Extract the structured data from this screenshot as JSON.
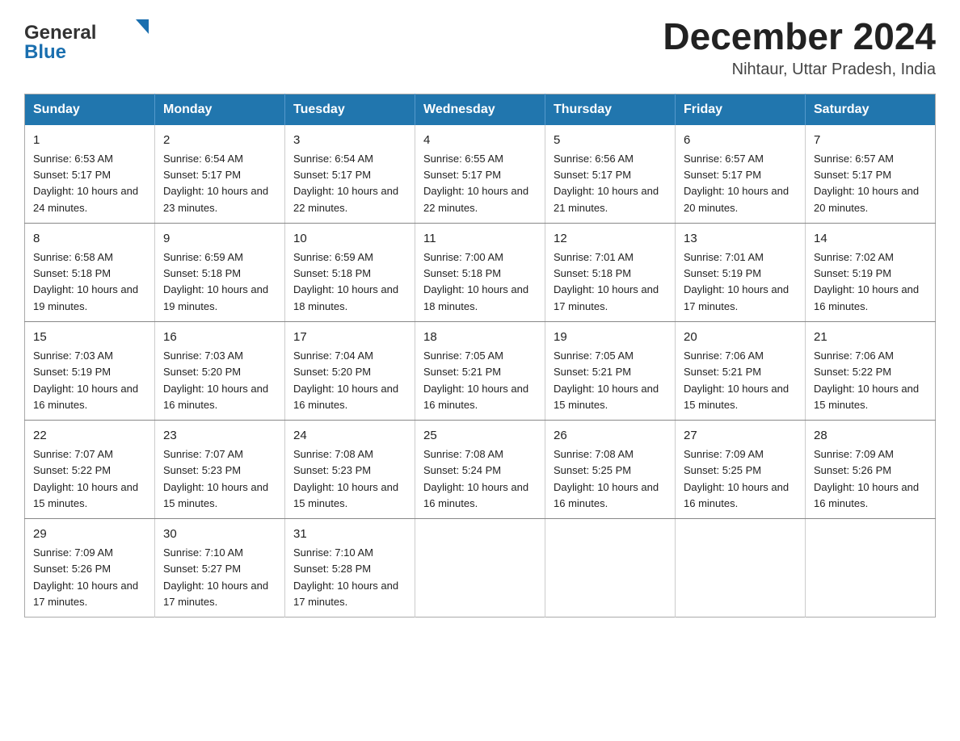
{
  "header": {
    "logo_general": "General",
    "logo_blue": "Blue",
    "month_title": "December 2024",
    "location": "Nihtaur, Uttar Pradesh, India"
  },
  "calendar": {
    "days_of_week": [
      "Sunday",
      "Monday",
      "Tuesday",
      "Wednesday",
      "Thursday",
      "Friday",
      "Saturday"
    ],
    "weeks": [
      [
        {
          "day": "1",
          "sunrise": "Sunrise: 6:53 AM",
          "sunset": "Sunset: 5:17 PM",
          "daylight": "Daylight: 10 hours and 24 minutes."
        },
        {
          "day": "2",
          "sunrise": "Sunrise: 6:54 AM",
          "sunset": "Sunset: 5:17 PM",
          "daylight": "Daylight: 10 hours and 23 minutes."
        },
        {
          "day": "3",
          "sunrise": "Sunrise: 6:54 AM",
          "sunset": "Sunset: 5:17 PM",
          "daylight": "Daylight: 10 hours and 22 minutes."
        },
        {
          "day": "4",
          "sunrise": "Sunrise: 6:55 AM",
          "sunset": "Sunset: 5:17 PM",
          "daylight": "Daylight: 10 hours and 22 minutes."
        },
        {
          "day": "5",
          "sunrise": "Sunrise: 6:56 AM",
          "sunset": "Sunset: 5:17 PM",
          "daylight": "Daylight: 10 hours and 21 minutes."
        },
        {
          "day": "6",
          "sunrise": "Sunrise: 6:57 AM",
          "sunset": "Sunset: 5:17 PM",
          "daylight": "Daylight: 10 hours and 20 minutes."
        },
        {
          "day": "7",
          "sunrise": "Sunrise: 6:57 AM",
          "sunset": "Sunset: 5:17 PM",
          "daylight": "Daylight: 10 hours and 20 minutes."
        }
      ],
      [
        {
          "day": "8",
          "sunrise": "Sunrise: 6:58 AM",
          "sunset": "Sunset: 5:18 PM",
          "daylight": "Daylight: 10 hours and 19 minutes."
        },
        {
          "day": "9",
          "sunrise": "Sunrise: 6:59 AM",
          "sunset": "Sunset: 5:18 PM",
          "daylight": "Daylight: 10 hours and 19 minutes."
        },
        {
          "day": "10",
          "sunrise": "Sunrise: 6:59 AM",
          "sunset": "Sunset: 5:18 PM",
          "daylight": "Daylight: 10 hours and 18 minutes."
        },
        {
          "day": "11",
          "sunrise": "Sunrise: 7:00 AM",
          "sunset": "Sunset: 5:18 PM",
          "daylight": "Daylight: 10 hours and 18 minutes."
        },
        {
          "day": "12",
          "sunrise": "Sunrise: 7:01 AM",
          "sunset": "Sunset: 5:18 PM",
          "daylight": "Daylight: 10 hours and 17 minutes."
        },
        {
          "day": "13",
          "sunrise": "Sunrise: 7:01 AM",
          "sunset": "Sunset: 5:19 PM",
          "daylight": "Daylight: 10 hours and 17 minutes."
        },
        {
          "day": "14",
          "sunrise": "Sunrise: 7:02 AM",
          "sunset": "Sunset: 5:19 PM",
          "daylight": "Daylight: 10 hours and 16 minutes."
        }
      ],
      [
        {
          "day": "15",
          "sunrise": "Sunrise: 7:03 AM",
          "sunset": "Sunset: 5:19 PM",
          "daylight": "Daylight: 10 hours and 16 minutes."
        },
        {
          "day": "16",
          "sunrise": "Sunrise: 7:03 AM",
          "sunset": "Sunset: 5:20 PM",
          "daylight": "Daylight: 10 hours and 16 minutes."
        },
        {
          "day": "17",
          "sunrise": "Sunrise: 7:04 AM",
          "sunset": "Sunset: 5:20 PM",
          "daylight": "Daylight: 10 hours and 16 minutes."
        },
        {
          "day": "18",
          "sunrise": "Sunrise: 7:05 AM",
          "sunset": "Sunset: 5:21 PM",
          "daylight": "Daylight: 10 hours and 16 minutes."
        },
        {
          "day": "19",
          "sunrise": "Sunrise: 7:05 AM",
          "sunset": "Sunset: 5:21 PM",
          "daylight": "Daylight: 10 hours and 15 minutes."
        },
        {
          "day": "20",
          "sunrise": "Sunrise: 7:06 AM",
          "sunset": "Sunset: 5:21 PM",
          "daylight": "Daylight: 10 hours and 15 minutes."
        },
        {
          "day": "21",
          "sunrise": "Sunrise: 7:06 AM",
          "sunset": "Sunset: 5:22 PM",
          "daylight": "Daylight: 10 hours and 15 minutes."
        }
      ],
      [
        {
          "day": "22",
          "sunrise": "Sunrise: 7:07 AM",
          "sunset": "Sunset: 5:22 PM",
          "daylight": "Daylight: 10 hours and 15 minutes."
        },
        {
          "day": "23",
          "sunrise": "Sunrise: 7:07 AM",
          "sunset": "Sunset: 5:23 PM",
          "daylight": "Daylight: 10 hours and 15 minutes."
        },
        {
          "day": "24",
          "sunrise": "Sunrise: 7:08 AM",
          "sunset": "Sunset: 5:23 PM",
          "daylight": "Daylight: 10 hours and 15 minutes."
        },
        {
          "day": "25",
          "sunrise": "Sunrise: 7:08 AM",
          "sunset": "Sunset: 5:24 PM",
          "daylight": "Daylight: 10 hours and 16 minutes."
        },
        {
          "day": "26",
          "sunrise": "Sunrise: 7:08 AM",
          "sunset": "Sunset: 5:25 PM",
          "daylight": "Daylight: 10 hours and 16 minutes."
        },
        {
          "day": "27",
          "sunrise": "Sunrise: 7:09 AM",
          "sunset": "Sunset: 5:25 PM",
          "daylight": "Daylight: 10 hours and 16 minutes."
        },
        {
          "day": "28",
          "sunrise": "Sunrise: 7:09 AM",
          "sunset": "Sunset: 5:26 PM",
          "daylight": "Daylight: 10 hours and 16 minutes."
        }
      ],
      [
        {
          "day": "29",
          "sunrise": "Sunrise: 7:09 AM",
          "sunset": "Sunset: 5:26 PM",
          "daylight": "Daylight: 10 hours and 17 minutes."
        },
        {
          "day": "30",
          "sunrise": "Sunrise: 7:10 AM",
          "sunset": "Sunset: 5:27 PM",
          "daylight": "Daylight: 10 hours and 17 minutes."
        },
        {
          "day": "31",
          "sunrise": "Sunrise: 7:10 AM",
          "sunset": "Sunset: 5:28 PM",
          "daylight": "Daylight: 10 hours and 17 minutes."
        },
        null,
        null,
        null,
        null
      ]
    ]
  }
}
